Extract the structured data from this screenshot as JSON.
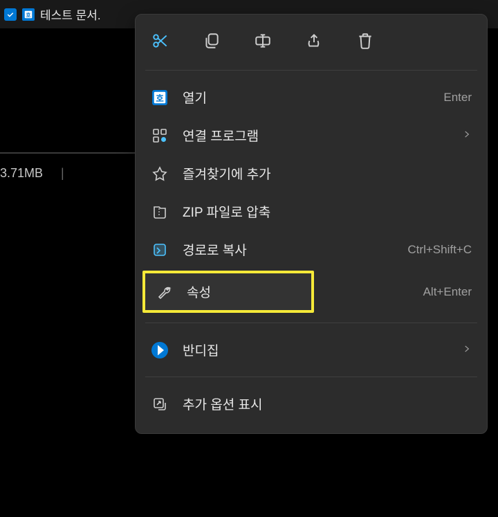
{
  "header": {
    "file_name": "테스트 문서."
  },
  "status": {
    "size": "3.71MB"
  },
  "toolbar": {
    "cut": "cut",
    "copy": "copy",
    "rename": "rename",
    "share": "share",
    "delete": "delete"
  },
  "menu": {
    "open": {
      "label": "열기",
      "shortcut": "Enter"
    },
    "open_with": {
      "label": "연결 프로그램"
    },
    "favorite": {
      "label": "즐겨찾기에 추가"
    },
    "zip": {
      "label": "ZIP 파일로 압축"
    },
    "copy_path": {
      "label": "경로로 복사",
      "shortcut": "Ctrl+Shift+C"
    },
    "properties": {
      "label": "속성",
      "shortcut": "Alt+Enter"
    },
    "bandizip": {
      "label": "반디집"
    },
    "more": {
      "label": "추가 옵션 표시"
    }
  }
}
